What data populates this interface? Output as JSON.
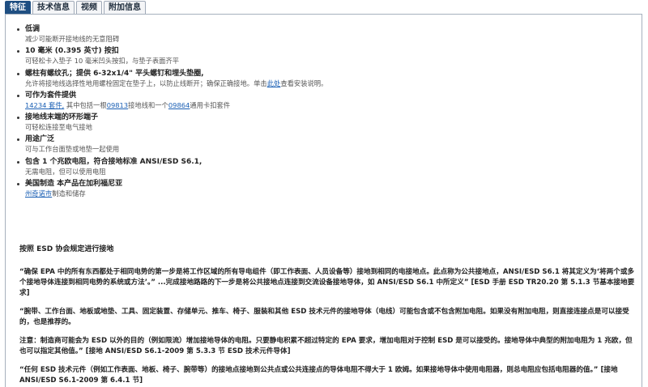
{
  "tabs": [
    {
      "label": "特征",
      "active": true
    },
    {
      "label": "技术信息",
      "active": false
    },
    {
      "label": "视频",
      "active": false
    },
    {
      "label": "附加信息",
      "active": false
    }
  ],
  "features": [
    {
      "title": "低调",
      "desc": "减少可能断开接地线的无意阻碍"
    },
    {
      "title": "10 毫米 (0.395 英寸) 按扣",
      "desc": "可轻松卡入垫子 10 毫米凹头按扣，与垫子表面齐平"
    },
    {
      "title": "螺柱有螺纹孔；提供 6-32x1/4\" 平头螺钉和埋头垫圈,",
      "desc_before": "允许将接地线选择性地用螺栓固定在垫子上，以防止线断开；确保正确接地。单击",
      "desc_link": "此处",
      "desc_after": "查看安装说明。"
    },
    {
      "title": "可作为套件提供",
      "link1": "14234 套件,",
      "mid1": " 其中包括一根",
      "link2": "09813",
      "mid2": "接地线和一个",
      "link3": "09864",
      "mid3": "通用卡扣套件"
    },
    {
      "title": "接地线末端的环形端子",
      "desc": "可轻松连接至电气接地"
    },
    {
      "title": "用途广泛",
      "desc": "可与工作台面垫或地垫一起使用"
    },
    {
      "title": "包含 1 个兆欧电阻，符合接地标准 ANSI/ESD S6.1,",
      "desc": "无需电阻，但可以使用电阻"
    },
    {
      "title": "美国制造 本产品在加利福尼亚",
      "desc_link": "州奇诺市",
      "desc_after": "制造和储存"
    }
  ],
  "section_heading": "按照 ESD 协会规定进行接地",
  "paragraphs": [
    "“确保 EPA 中的所有东西都处于相同电势的第一步是将工作区域的所有导电组件（即工作表面、人员设备等）接地到相同的电接地点。此点称为公共接地点，ANSI/ESD S6.1 将其定义为‘将两个或多个接地导体连接到相同电势的系统或方法’。” ...完成接地路路的下一步是将公共接地点连接到交流设备接地导体，如 ANSI/ESD S6.1 中所定义” [ESD 手册 ESD TR20.20 第 5.1.3 节基本接地要求]",
    "“腕带、工作台面、地板或地垫、工具、固定装置、存储单元、推车、椅子、服装和其他 ESD 技术元件的接地导体（电线）可能包含或不包含附加电阻。如果没有附加电阻，则直接连接点是可以接受的，也是推荐的。",
    "注意：制造商可能会为 ESD 以外的目的（例如限流）增加接地导体的电阻。只要静电积累不超过特定的 EPA 要求，增加电阻对于控制 ESD 是可以接受的。接地导体中典型的附加电阻为 1 兆欧，但也可以指定其他值。” [接地 ANSI/ESD S6.1-2009 第 5.3.3 节 ESD 技术元件导体]",
    "“任何 ESD 技术元件（例如工作表面、地板、椅子、腕带等）的接地点接地到公共点或公共连接点的导体电阻不得大于 1 欧姆。如果接地导体中使用电阻器，则总电阻应包括电阻器的值。” [接地 ANSI/ESD S6.1-2009 第 6.4.1 节]"
  ]
}
